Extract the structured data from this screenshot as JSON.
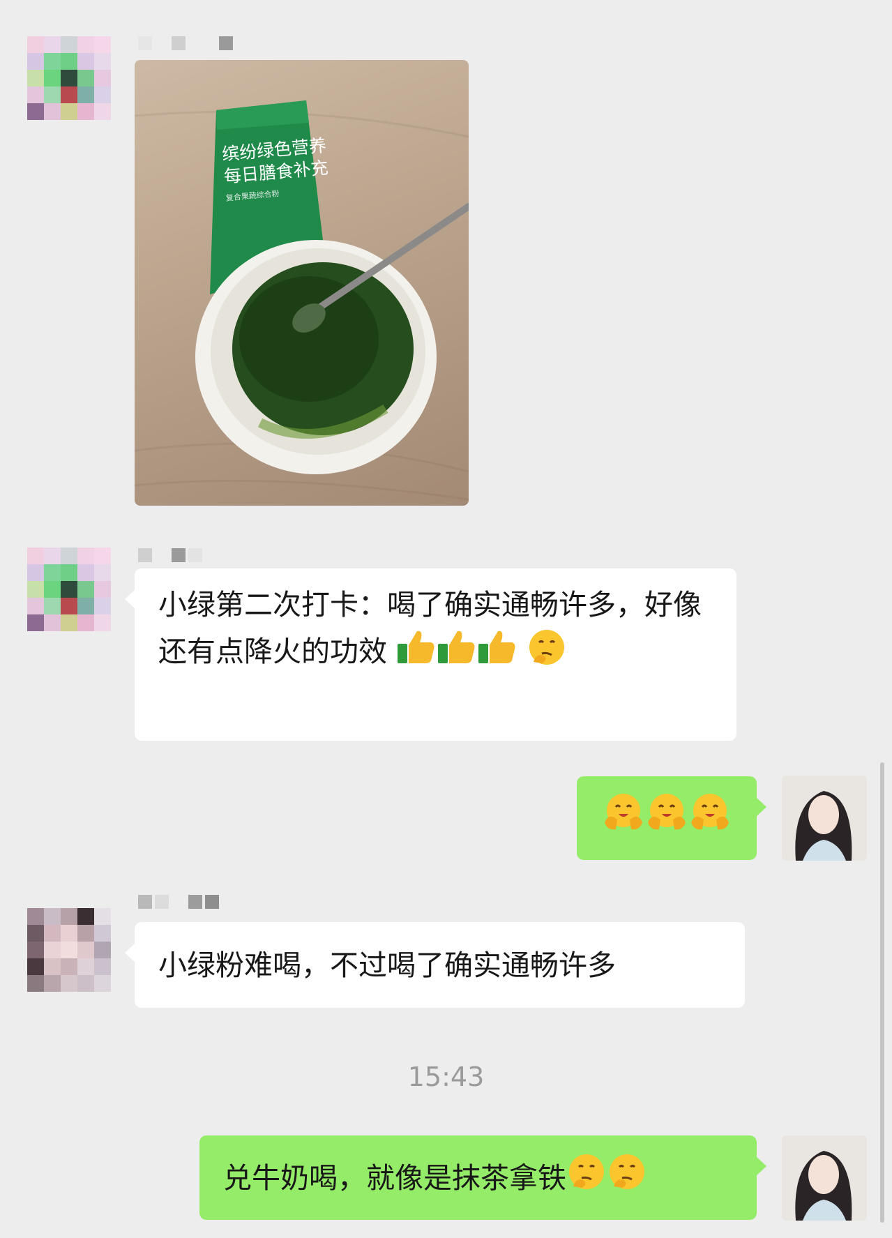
{
  "chat": {
    "photo_bag_line1": "缤纷绿色营养",
    "photo_bag_line2": "每日膳食补充",
    "photo_bag_line3": "复合果蔬综合粉",
    "msg1_text": "小绿第二次打卡：喝了确实通畅许多，好像还有点降火的功效",
    "msg2_text": "",
    "msg3_text": "小绿粉难喝，不过喝了确实通畅许多",
    "timestamp": "15:43",
    "msg4_text": "兑牛奶喝，就像是抹茶拿铁"
  },
  "emojis": {
    "msg1": [
      "thumbs-up-icon",
      "thumbs-up-icon",
      "thumbs-up-icon",
      "thinking-face-icon"
    ],
    "msg2": [
      "hugging-face-icon",
      "hugging-face-icon",
      "hugging-face-icon"
    ],
    "msg4": [
      "thinking-face-icon",
      "thinking-face-icon"
    ]
  },
  "colors": {
    "background": "#ededed",
    "incoming_bubble": "#ffffff",
    "outgoing_bubble": "#95ec69",
    "timestamp": "#9a9a9a"
  }
}
